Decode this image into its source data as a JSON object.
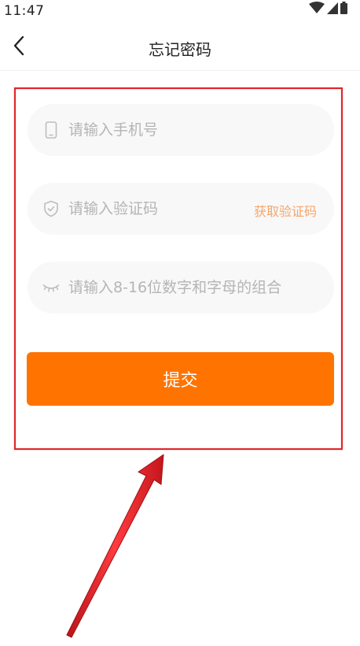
{
  "status_bar": {
    "time": "11:47",
    "icons": [
      "wifi-icon",
      "signal-icon",
      "battery-icon"
    ]
  },
  "nav": {
    "title": "忘记密码",
    "back_icon": "chevron-left-icon"
  },
  "form": {
    "phone": {
      "placeholder": "请输入手机号",
      "value": "",
      "icon": "phone-icon"
    },
    "code": {
      "placeholder": "请输入验证码",
      "value": "",
      "icon": "shield-check-icon",
      "get_code_label": "获取验证码"
    },
    "password": {
      "placeholder": "请输入8-16位数字和字母的组合",
      "value": "",
      "icon": "eye-closed-icon"
    },
    "submit_label": "提交"
  },
  "colors": {
    "accent": "#ff7300",
    "link": "#f6a56a",
    "field_bg": "#f8f8f8",
    "placeholder": "#b5b5b5",
    "annotation": "#e0262a"
  }
}
